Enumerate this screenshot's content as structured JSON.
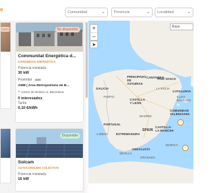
{
  "header": {
    "logo_text": "o",
    "filters": [
      {
        "label": "Comunidad"
      },
      {
        "label": "Provincia"
      },
      {
        "label": "Localidad"
      }
    ]
  },
  "left_cards": [
    {
      "label": "ctorio"
    }
  ],
  "cards": [
    {
      "title": "Communitat Energètica d...",
      "type": "COMUNIDAD ENERGÉTICA",
      "badge": "No disponible",
      "power_label": "Potencia instalada",
      "power_value": "30 kW",
      "promoter_label": "Promotor",
      "promoter_value": "AMB | Àrea Metropolitana de B...",
      "address": "Carrer de Bolsico 3, Barcelona",
      "interested": "0 interesados",
      "tariff_label": "Tarifa",
      "tariff_value": "0,10 €/kWh"
    },
    {
      "title": "Solcam",
      "type": "AUTOCONSUMO COLECTIVO",
      "badge": "Disponible",
      "power_label": "Potencia instalada",
      "power_value": "16 kW"
    }
  ],
  "map": {
    "zoom_in": "+",
    "zoom_out": "−",
    "locate_icon": "➤",
    "layer_select": "Base",
    "labels": [
      {
        "text": "GALICIA"
      },
      {
        "text": "PRINCIPADO DE ASTURIAS"
      },
      {
        "text": "CANTABRIA"
      },
      {
        "text": "PAÍS VASCO"
      },
      {
        "text": "CASTILLA Y LEÓN"
      },
      {
        "text": "CASTILLA-LA MANCHA"
      },
      {
        "text": "PORTUGAL"
      },
      {
        "text": "SPAIN"
      },
      {
        "text": "ANDALUCÍA"
      },
      {
        "text": "MADRID"
      },
      {
        "text": "LISBOA"
      },
      {
        "text": "SEVILLA"
      },
      {
        "text": "GRANADA"
      },
      {
        "text": "EXTREMADURA"
      },
      {
        "text": "MURCIA"
      },
      {
        "text": "COMUNIDAD VALENCIANA"
      },
      {
        "text": "LA RIOJA"
      },
      {
        "text": "PORTO"
      },
      {
        "text": "CATALUNYA"
      },
      {
        "text": "ILLES BALEARS"
      }
    ],
    "colors": {
      "water": "#aadaff",
      "land": "#f2efe9",
      "pin": "#d08b1a"
    }
  }
}
